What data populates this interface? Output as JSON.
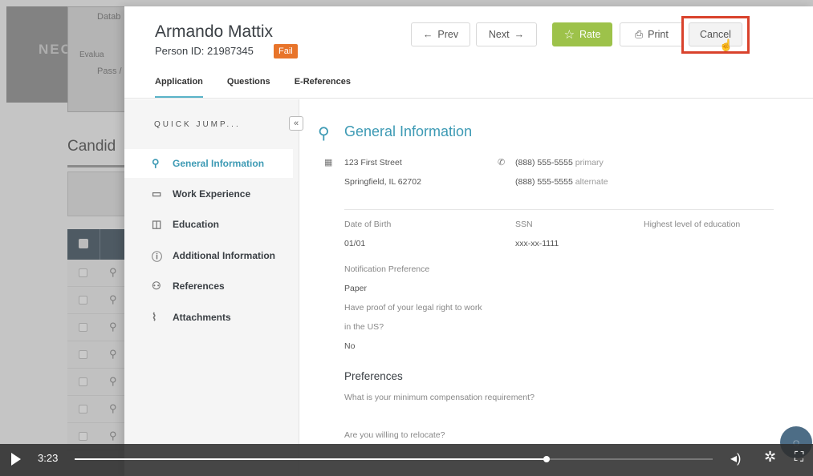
{
  "background": {
    "logo": "NEOGOV",
    "card_lines": [
      "Datab",
      "Evalua",
      "Pass /"
    ],
    "candidates_heading": "Candid"
  },
  "header": {
    "name": "Armando Mattix",
    "person_id": "Person ID: 21987345",
    "status_badge": "Fail",
    "prev_label": "Prev",
    "next_label": "Next",
    "rate_label": "Rate",
    "print_label": "Print",
    "cancel_label": "Cancel"
  },
  "tabs": [
    "Application",
    "Questions",
    "E-References"
  ],
  "sidebar": {
    "quick_jump": "QUICK JUMP...",
    "collapse_glyph": "«",
    "items": [
      {
        "icon": "person-icon",
        "glyph": "⚲",
        "label": "General Information"
      },
      {
        "icon": "briefcase-icon",
        "glyph": "▭",
        "label": "Work Experience"
      },
      {
        "icon": "graduation-icon",
        "glyph": "◫",
        "label": "Education"
      },
      {
        "icon": "info-icon",
        "glyph": "ⓘ",
        "label": "Additional Information"
      },
      {
        "icon": "people-icon",
        "glyph": "⚇",
        "label": "References"
      },
      {
        "icon": "paperclip-icon",
        "glyph": "⌇",
        "label": "Attachments"
      }
    ]
  },
  "content": {
    "title": "General Information",
    "address_line1": "123 First Street",
    "address_line2": "Springfield, IL 62702",
    "phone_primary": "(888) 555-5555",
    "phone_primary_tag": "primary",
    "phone_alternate": "(888) 555-5555",
    "phone_alternate_tag": "alternate",
    "dob_label": "Date of Birth",
    "dob_value": "01/01",
    "ssn_label": "SSN",
    "ssn_value": "xxx-xx-1111",
    "education_label": "Highest level of education",
    "notification_label": "Notification Preference",
    "notification_value": "Paper",
    "legal_q_line1": "Have proof of your legal right to work",
    "legal_q_line2": "in the US?",
    "legal_a": "No",
    "preferences_heading": "Preferences",
    "comp_q": "What is your minimum compensation requirement?",
    "relocate_q": "Are you willing to relocate?"
  },
  "video": {
    "time": "3:23",
    "progress": 0.74
  },
  "colors": {
    "accent": "#3d9ab4",
    "fail": "#e8742a",
    "rate": "#9dc24a",
    "highlight": "#d9422c"
  }
}
